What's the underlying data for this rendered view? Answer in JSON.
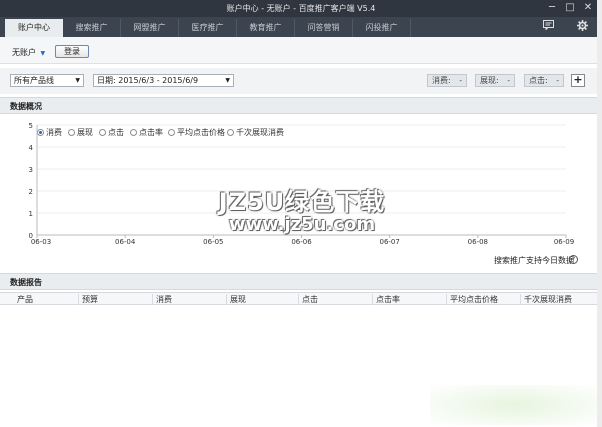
{
  "window": {
    "title": "账户中心 - 无账户 - 百度推广客户端 V5.4",
    "controls": [
      "─",
      "□",
      "✕"
    ]
  },
  "tabs": [
    {
      "label": "账户中心",
      "active": true
    },
    {
      "label": "搜索推广",
      "active": false
    },
    {
      "label": "网盟推广",
      "active": false
    },
    {
      "label": "医疗推广",
      "active": false
    },
    {
      "label": "教育推广",
      "active": false
    },
    {
      "label": "问答营销",
      "active": false
    },
    {
      "label": "闪投推广",
      "active": false
    }
  ],
  "tab_icons": {
    "message": "message-icon",
    "settings": "gear-icon"
  },
  "userbar": {
    "account_select": "无账户",
    "login_label": "登录"
  },
  "filters": {
    "product": "所有产品线",
    "date": "日期: 2015/6/3 - 2015/6/9",
    "metrics": [
      {
        "label": "消费:",
        "value": "-"
      },
      {
        "label": "展现:",
        "value": "-"
      },
      {
        "label": "点击:",
        "value": "-"
      }
    ],
    "add_label": "+"
  },
  "overview": {
    "title": "数据概况",
    "options": [
      {
        "label": "消费",
        "selected": true
      },
      {
        "label": "展现",
        "selected": false
      },
      {
        "label": "点击",
        "selected": false
      },
      {
        "label": "点击率",
        "selected": false
      },
      {
        "label": "平均点击价格",
        "selected": false
      },
      {
        "label": "千次展现消费",
        "selected": false
      }
    ],
    "today_note": "搜索推广支持今日数据",
    "help": "?"
  },
  "chart_data": {
    "type": "line",
    "x": [
      "06-03",
      "06-04",
      "06-05",
      "06-06",
      "06-07",
      "06-08",
      "06-09"
    ],
    "yticks": [
      0,
      1,
      2,
      3,
      4,
      5
    ],
    "ylim": [
      0,
      5
    ],
    "series": [],
    "grid": true
  },
  "report": {
    "title": "数据报告",
    "columns": [
      "产品",
      "预算",
      "消费",
      "展现",
      "点击",
      "点击率",
      "平均点击价格",
      "千次展现消费"
    ]
  },
  "watermark": {
    "line1": "JZ5U绿色下载",
    "line2": "www.jz5u.com"
  }
}
